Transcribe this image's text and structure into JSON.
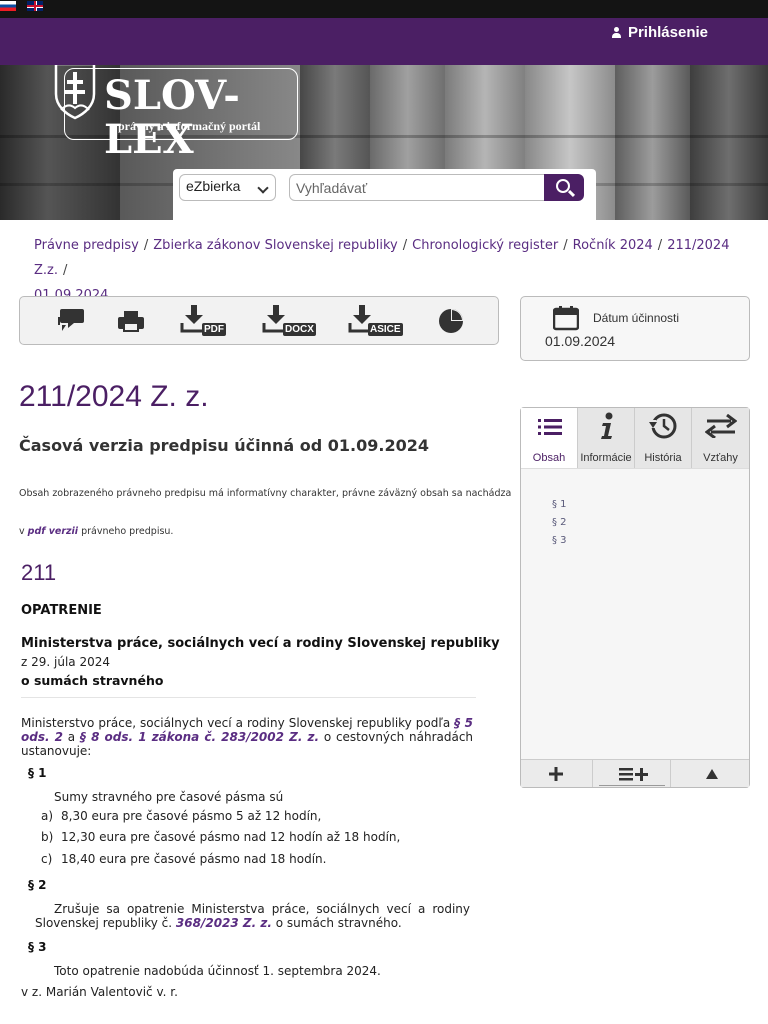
{
  "header": {
    "login_label": "Prihlásenie",
    "logo_title": "SLOV-LEX",
    "logo_subtitle": "právny a informačný portál",
    "flags": [
      "flag-sk",
      "flag-gb"
    ]
  },
  "search": {
    "collection_selected": "eZbierka",
    "placeholder": "Vyhľadávať",
    "button_icon": "search-icon"
  },
  "breadcrumb": {
    "items": [
      "Právne predpisy",
      "Zbierka zákonov Slovenskej republiky",
      "Chronologický register",
      "Ročník 2024",
      "211/2024 Z.z.",
      "01.09.2024"
    ],
    "separator": "/"
  },
  "toolbar": {
    "icons": [
      "comments-icon",
      "print-icon",
      "download-pdf-icon",
      "download-docx-icon",
      "download-asice-icon",
      "pie-chart-icon"
    ],
    "pdf_badge": "PDF",
    "docx_badge": "DOCX",
    "asice_badge": "ASICE"
  },
  "effective_date": {
    "label": "Dátum účinnosti",
    "value": "01.09.2024",
    "icon": "calendar-icon"
  },
  "document": {
    "title": "211/2024 Z. z.",
    "version_heading": "Časová verzia predpisu účinná od 01.09.2024",
    "notice_line1": "Obsah zobrazeného právneho predpisu má informatívny charakter, právne záväzný obsah sa nachádza",
    "notice_line2_prefix": "v ",
    "notice_link": "pdf verzii",
    "notice_line2_suffix": " právneho predpisu.",
    "number": "211",
    "type": "OPATRENIE",
    "issuer": "Ministerstva práce, sociálnych vecí a rodiny Slovenskej republiky",
    "date": "z 29. júla 2024",
    "subject": "o sumách stravného",
    "intro_prefix": "Ministerstvo práce, sociálnych vecí a rodiny Slovenskej republiky podľa ",
    "intro_link1": "§ 5 ods. 2",
    "intro_mid": " a ",
    "intro_link2": "§ 8 ods. 1 zákona č. 283/2002 Z. z.",
    "intro_suffix": " o cestovných náhradách ustanovuje:",
    "p1_head": "§ 1",
    "p1_text": "Sumy stravného pre časové pásma sú",
    "p1_items": [
      {
        "letter": "a)",
        "text": "8,30 eura pre časové pásmo 5 až 12 hodín,"
      },
      {
        "letter": "b)",
        "text": "12,30 eura pre časové pásmo nad 12 hodín až 18 hodín,"
      },
      {
        "letter": "c)",
        "text": "18,40 eura pre časové pásmo nad 18 hodín."
      }
    ],
    "p2_head": "§ 2",
    "p2_prefix": "Zrušuje sa opatrenie Ministerstva práce, sociálnych vecí a rodiny Slovenskej republiky č. ",
    "p2_link": "368/2023 Z. z.",
    "p2_suffix": " o sumách stravného.",
    "p3_head": "§ 3",
    "p3_text": "Toto opatrenie nadobúda účinnosť 1. septembra 2024.",
    "signature": "v z. Marián Valentovič v. r."
  },
  "side_panel": {
    "tabs": [
      {
        "label": "Obsah",
        "icon": "list-icon",
        "active": true
      },
      {
        "label": "Informácie",
        "icon": "info-icon",
        "active": false
      },
      {
        "label": "História",
        "icon": "history-icon",
        "active": false
      },
      {
        "label": "Vzťahy",
        "icon": "relations-icon",
        "active": false
      }
    ],
    "toc": [
      "§ 1",
      "§ 2",
      "§ 3"
    ],
    "footer_icons": [
      "plus-icon",
      "expand-list-icon",
      "triangle-up-icon"
    ]
  },
  "colors": {
    "brand_purple": "#4b1f64",
    "link_purple": "#5a2d82"
  }
}
